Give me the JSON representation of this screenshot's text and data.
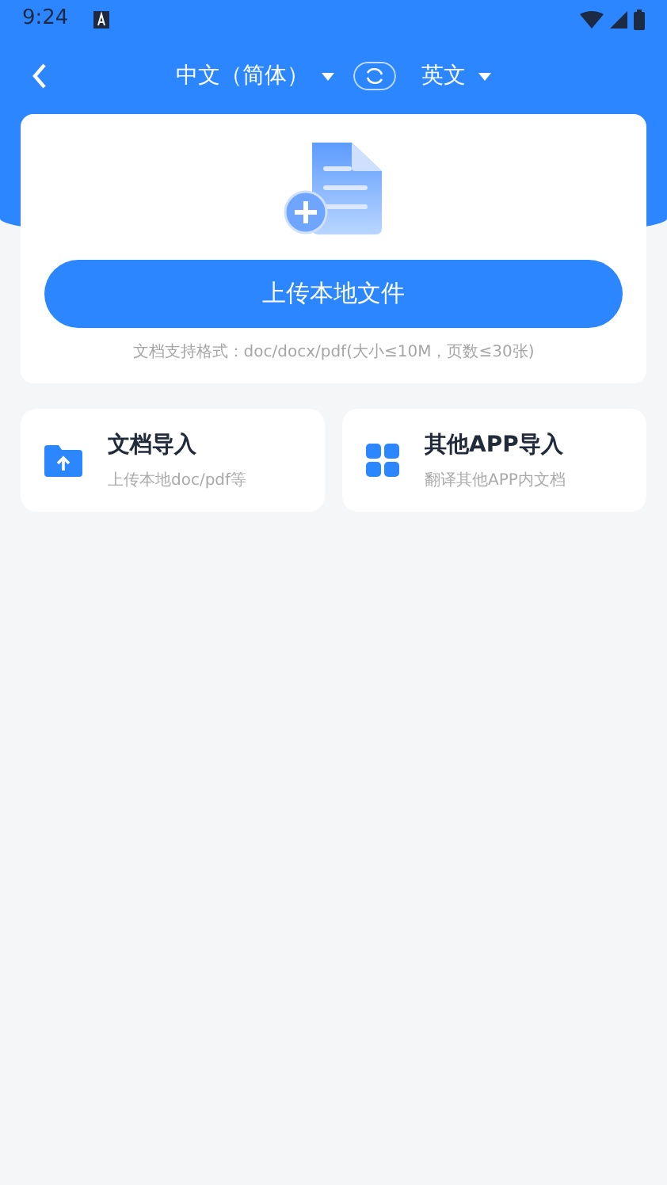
{
  "status_bar": {
    "time": "9:24"
  },
  "header": {
    "source_language": "中文（简体）",
    "target_language": "英文"
  },
  "upload": {
    "button": "上传本地文件",
    "note": "文档支持格式：doc/docx/pdf(大小≤10M，页数≤30张)"
  },
  "imports": [
    {
      "kind": "folder",
      "title": "文档导入",
      "subtitle": "上传本地doc/pdf等"
    },
    {
      "kind": "apps",
      "title": "其他APP导入",
      "subtitle": "翻译其他APP内文档"
    }
  ]
}
